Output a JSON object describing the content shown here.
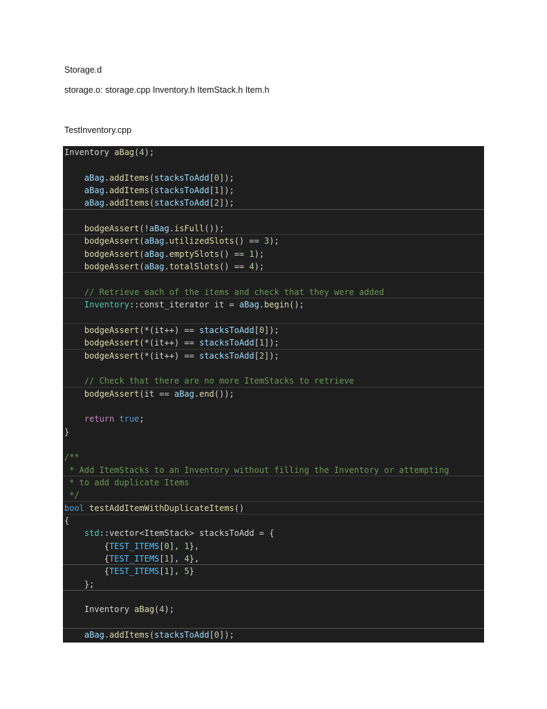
{
  "document": {
    "lines": [
      "Storage.d",
      "storage.o: storage.cpp Inventory.h ItemStack.h Item.h",
      "TestInventory.cpp"
    ]
  },
  "colors": {
    "code_background": "#1e1e1e",
    "plain": "#d4d4d4",
    "variable": "#9cdcfe",
    "function": "#dcdcaa",
    "type": "#4ec9b0",
    "number": "#b5cea8",
    "keyword": "#569cd6",
    "control": "#c586c0",
    "comment": "#6a9955"
  },
  "code": {
    "language": "cpp",
    "lines": [
      {
        "sep": false,
        "tokens": [
          [
            "plain",
            "Inventory "
          ],
          [
            "fn",
            "aBag"
          ],
          [
            "plain",
            "("
          ],
          [
            "num",
            "4"
          ],
          [
            "plain",
            ");"
          ]
        ]
      },
      {
        "sep": false,
        "tokens": []
      },
      {
        "sep": false,
        "tokens": [
          [
            "plain",
            "    "
          ],
          [
            "var",
            "aBag"
          ],
          [
            "plain",
            "."
          ],
          [
            "fn",
            "addItems"
          ],
          [
            "plain",
            "("
          ],
          [
            "var",
            "stacksToAdd"
          ],
          [
            "plain",
            "["
          ],
          [
            "num",
            "0"
          ],
          [
            "plain",
            "]);"
          ]
        ]
      },
      {
        "sep": false,
        "tokens": [
          [
            "plain",
            "    "
          ],
          [
            "var",
            "aBag"
          ],
          [
            "plain",
            "."
          ],
          [
            "fn",
            "addItems"
          ],
          [
            "plain",
            "("
          ],
          [
            "var",
            "stacksToAdd"
          ],
          [
            "plain",
            "["
          ],
          [
            "num",
            "1"
          ],
          [
            "plain",
            "]);"
          ]
        ]
      },
      {
        "sep": "strong",
        "tokens": [
          [
            "plain",
            "    "
          ],
          [
            "var",
            "aBag"
          ],
          [
            "plain",
            "."
          ],
          [
            "fn",
            "addItems"
          ],
          [
            "plain",
            "("
          ],
          [
            "var",
            "stacksToAdd"
          ],
          [
            "plain",
            "["
          ],
          [
            "num",
            "2"
          ],
          [
            "plain",
            "]);"
          ]
        ]
      },
      {
        "sep": false,
        "tokens": []
      },
      {
        "sep": true,
        "tokens": [
          [
            "plain",
            "    "
          ],
          [
            "fn",
            "bodgeAssert"
          ],
          [
            "plain",
            "(!"
          ],
          [
            "var",
            "aBag"
          ],
          [
            "plain",
            "."
          ],
          [
            "fn",
            "isFull"
          ],
          [
            "plain",
            "());"
          ]
        ]
      },
      {
        "sep": false,
        "tokens": [
          [
            "plain",
            "    "
          ],
          [
            "fn",
            "bodgeAssert"
          ],
          [
            "plain",
            "("
          ],
          [
            "var",
            "aBag"
          ],
          [
            "plain",
            "."
          ],
          [
            "fn",
            "utilizedSlots"
          ],
          [
            "plain",
            "() == "
          ],
          [
            "num",
            "3"
          ],
          [
            "plain",
            ");"
          ]
        ]
      },
      {
        "sep": false,
        "tokens": [
          [
            "plain",
            "    "
          ],
          [
            "fn",
            "bodgeAssert"
          ],
          [
            "plain",
            "("
          ],
          [
            "var",
            "aBag"
          ],
          [
            "plain",
            "."
          ],
          [
            "fn",
            "emptySlots"
          ],
          [
            "plain",
            "() == "
          ],
          [
            "num",
            "1"
          ],
          [
            "plain",
            ");"
          ]
        ]
      },
      {
        "sep": true,
        "tokens": [
          [
            "plain",
            "    "
          ],
          [
            "fn",
            "bodgeAssert"
          ],
          [
            "plain",
            "("
          ],
          [
            "var",
            "aBag"
          ],
          [
            "plain",
            "."
          ],
          [
            "fn",
            "totalSlots"
          ],
          [
            "plain",
            "() == "
          ],
          [
            "num",
            "4"
          ],
          [
            "plain",
            ");"
          ]
        ]
      },
      {
        "sep": false,
        "tokens": []
      },
      {
        "sep": true,
        "tokens": [
          [
            "plain",
            "    "
          ],
          [
            "com",
            "// Retrieve each of the items and check that they were added"
          ]
        ]
      },
      {
        "sep": false,
        "tokens": [
          [
            "plain",
            "    "
          ],
          [
            "type",
            "Inventory"
          ],
          [
            "plain",
            "::const_iterator it = "
          ],
          [
            "var",
            "aBag"
          ],
          [
            "plain",
            "."
          ],
          [
            "fn",
            "begin"
          ],
          [
            "plain",
            "();"
          ]
        ]
      },
      {
        "sep": true,
        "tokens": []
      },
      {
        "sep": false,
        "tokens": [
          [
            "plain",
            "    "
          ],
          [
            "fn",
            "bodgeAssert"
          ],
          [
            "plain",
            "(*(it++) == "
          ],
          [
            "var",
            "stacksToAdd"
          ],
          [
            "plain",
            "["
          ],
          [
            "num",
            "0"
          ],
          [
            "plain",
            "]);"
          ]
        ]
      },
      {
        "sep": true,
        "tokens": [
          [
            "plain",
            "    "
          ],
          [
            "fn",
            "bodgeAssert"
          ],
          [
            "plain",
            "(*(it++) == "
          ],
          [
            "var",
            "stacksToAdd"
          ],
          [
            "plain",
            "["
          ],
          [
            "num",
            "1"
          ],
          [
            "plain",
            "]);"
          ]
        ]
      },
      {
        "sep": false,
        "tokens": [
          [
            "plain",
            "    "
          ],
          [
            "fn",
            "bodgeAssert"
          ],
          [
            "plain",
            "(*(it++) == "
          ],
          [
            "var",
            "stacksToAdd"
          ],
          [
            "plain",
            "["
          ],
          [
            "num",
            "2"
          ],
          [
            "plain",
            "]);"
          ]
        ]
      },
      {
        "sep": false,
        "tokens": []
      },
      {
        "sep": true,
        "tokens": [
          [
            "plain",
            "    "
          ],
          [
            "com",
            "// Check that there are no more ItemStacks to retrieve"
          ]
        ]
      },
      {
        "sep": false,
        "tokens": [
          [
            "plain",
            "    "
          ],
          [
            "fn",
            "bodgeAssert"
          ],
          [
            "plain",
            "(it == "
          ],
          [
            "var",
            "aBag"
          ],
          [
            "plain",
            "."
          ],
          [
            "fn",
            "end"
          ],
          [
            "plain",
            "());"
          ]
        ]
      },
      {
        "sep": false,
        "tokens": []
      },
      {
        "sep": false,
        "tokens": [
          [
            "plain",
            "    "
          ],
          [
            "ctrl",
            "return"
          ],
          [
            "plain",
            " "
          ],
          [
            "kw",
            "true"
          ],
          [
            "plain",
            ";"
          ]
        ]
      },
      {
        "sep": false,
        "tokens": [
          [
            "plain",
            "}"
          ]
        ]
      },
      {
        "sep": false,
        "tokens": []
      },
      {
        "sep": false,
        "tokens": [
          [
            "com",
            "/**"
          ]
        ]
      },
      {
        "sep": true,
        "tokens": [
          [
            "com",
            " * Add ItemStacks to an Inventory without filling the Inventory or attempting"
          ]
        ]
      },
      {
        "sep": false,
        "tokens": [
          [
            "com",
            " * to add duplicate Items"
          ]
        ]
      },
      {
        "sep": true,
        "tokens": [
          [
            "com",
            " */"
          ]
        ]
      },
      {
        "sep": true,
        "tokens": [
          [
            "kw",
            "bool"
          ],
          [
            "plain",
            " "
          ],
          [
            "fn",
            "testAddItemWithDuplicateItems"
          ],
          [
            "plain",
            "()"
          ]
        ]
      },
      {
        "sep": false,
        "tokens": [
          [
            "plain",
            "{"
          ]
        ]
      },
      {
        "sep": false,
        "tokens": [
          [
            "plain",
            "    "
          ],
          [
            "type",
            "std"
          ],
          [
            "plain",
            "::vector<ItemStack> stacksToAdd = {"
          ]
        ]
      },
      {
        "sep": false,
        "tokens": [
          [
            "plain",
            "        {"
          ],
          [
            "const",
            "TEST_ITEMS"
          ],
          [
            "plain",
            "["
          ],
          [
            "num",
            "0"
          ],
          [
            "plain",
            "], "
          ],
          [
            "num",
            "1"
          ],
          [
            "plain",
            "},"
          ]
        ]
      },
      {
        "sep": "strong",
        "tokens": [
          [
            "plain",
            "        {"
          ],
          [
            "const",
            "TEST_ITEMS"
          ],
          [
            "plain",
            "["
          ],
          [
            "num",
            "1"
          ],
          [
            "plain",
            "], "
          ],
          [
            "num",
            "4"
          ],
          [
            "plain",
            "},"
          ]
        ]
      },
      {
        "sep": false,
        "tokens": [
          [
            "plain",
            "        {"
          ],
          [
            "const",
            "TEST_ITEMS"
          ],
          [
            "plain",
            "["
          ],
          [
            "num",
            "1"
          ],
          [
            "plain",
            "], "
          ],
          [
            "num",
            "5"
          ],
          [
            "plain",
            "}"
          ]
        ]
      },
      {
        "sep": "strong",
        "tokens": [
          [
            "plain",
            "    };"
          ]
        ]
      },
      {
        "sep": false,
        "tokens": []
      },
      {
        "sep": false,
        "tokens": [
          [
            "plain",
            "    Inventory "
          ],
          [
            "fn",
            "aBag"
          ],
          [
            "plain",
            "("
          ],
          [
            "num",
            "4"
          ],
          [
            "plain",
            ");"
          ]
        ]
      },
      {
        "sep": "strong",
        "tokens": []
      },
      {
        "sep": false,
        "tokens": [
          [
            "plain",
            "    "
          ],
          [
            "var",
            "aBag"
          ],
          [
            "plain",
            "."
          ],
          [
            "fn",
            "addItems"
          ],
          [
            "plain",
            "("
          ],
          [
            "var",
            "stacksToAdd"
          ],
          [
            "plain",
            "["
          ],
          [
            "num",
            "0"
          ],
          [
            "plain",
            "]);"
          ]
        ]
      }
    ]
  }
}
